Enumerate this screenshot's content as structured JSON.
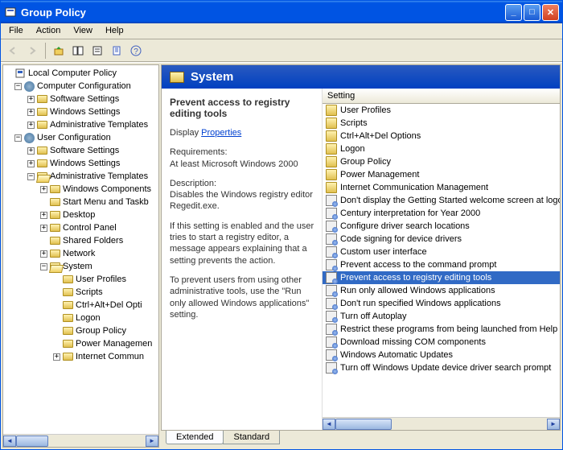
{
  "window": {
    "title": "Group Policy"
  },
  "menu": {
    "file": "File",
    "action": "Action",
    "view": "View",
    "help": "Help"
  },
  "tree": {
    "root": "Local Computer Policy",
    "cc": "Computer Configuration",
    "cc_ss": "Software Settings",
    "cc_ws": "Windows Settings",
    "cc_at": "Administrative Templates",
    "uc": "User Configuration",
    "uc_ss": "Software Settings",
    "uc_ws": "Windows Settings",
    "uc_at": "Administrative Templates",
    "wcomp": "Windows Components",
    "smtb": "Start Menu and Taskb",
    "desktop": "Desktop",
    "cpanel": "Control Panel",
    "sfold": "Shared Folders",
    "network": "Network",
    "system": "System",
    "uprof": "User Profiles",
    "scripts": "Scripts",
    "cad": "Ctrl+Alt+Del Opti",
    "logon": "Logon",
    "gpolicy": "Group Policy",
    "pmgmt": "Power Managemen",
    "icomm": "Internet Commun"
  },
  "detail": {
    "header": "System",
    "setting_title": "Prevent access to registry editing tools",
    "display": "Display",
    "properties": "Properties",
    "req_label": "Requirements:",
    "req_text": "At least Microsoft Windows 2000",
    "desc_label": "Description:",
    "desc_text": "Disables the Windows registry editor Regedit.exe.",
    "desc_text2": "If this setting is enabled and the user tries to start a registry editor, a message appears explaining that a setting prevents the action.",
    "desc_text3": "To prevent users from using other administrative tools, use the \"Run only allowed Windows applications\" setting."
  },
  "list": {
    "header": "Setting",
    "items": [
      {
        "t": "folder",
        "label": "User Profiles"
      },
      {
        "t": "folder",
        "label": "Scripts"
      },
      {
        "t": "folder",
        "label": "Ctrl+Alt+Del Options"
      },
      {
        "t": "folder",
        "label": "Logon"
      },
      {
        "t": "folder",
        "label": "Group Policy"
      },
      {
        "t": "folder",
        "label": "Power Management"
      },
      {
        "t": "folder",
        "label": "Internet Communication Management"
      },
      {
        "t": "setting",
        "label": "Don't display the Getting Started welcome screen at logon"
      },
      {
        "t": "setting",
        "label": "Century interpretation for Year 2000"
      },
      {
        "t": "setting",
        "label": "Configure driver search locations"
      },
      {
        "t": "setting",
        "label": "Code signing for device drivers"
      },
      {
        "t": "setting",
        "label": "Custom user interface"
      },
      {
        "t": "setting",
        "label": "Prevent access to the command prompt"
      },
      {
        "t": "setting",
        "label": "Prevent access to registry editing tools",
        "selected": true
      },
      {
        "t": "setting",
        "label": "Run only allowed Windows applications"
      },
      {
        "t": "setting",
        "label": "Don't run specified Windows applications"
      },
      {
        "t": "setting",
        "label": "Turn off Autoplay"
      },
      {
        "t": "setting",
        "label": "Restrict these programs from being launched from Help"
      },
      {
        "t": "setting",
        "label": "Download missing COM components"
      },
      {
        "t": "setting",
        "label": "Windows Automatic Updates"
      },
      {
        "t": "setting",
        "label": "Turn off Windows Update device driver search prompt"
      }
    ]
  },
  "tabs": {
    "extended": "Extended",
    "standard": "Standard"
  }
}
